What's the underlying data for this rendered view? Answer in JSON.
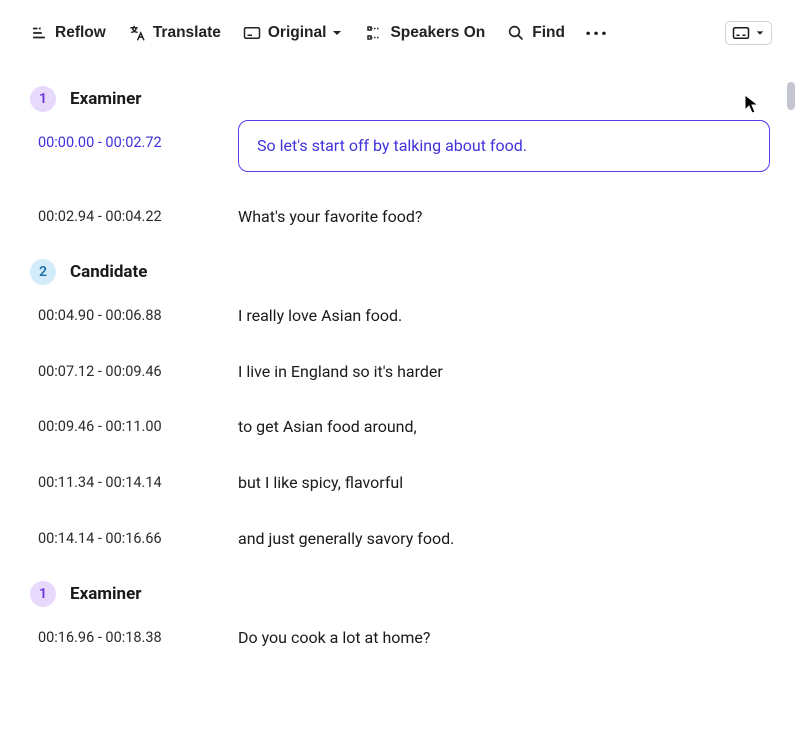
{
  "toolbar": {
    "reflow": "Reflow",
    "translate": "Translate",
    "original": "Original",
    "speakers": "Speakers On",
    "find": "Find"
  },
  "speakers": {
    "examiner": {
      "num": "1",
      "name": "Examiner"
    },
    "candidate": {
      "num": "2",
      "name": "Candidate"
    }
  },
  "lines": {
    "l1": {
      "ts": "00:00.00 - 00:02.72",
      "txt": "So let's start off by talking about food."
    },
    "l2": {
      "ts": "00:02.94 - 00:04.22",
      "txt": "What's your favorite food?"
    },
    "l3": {
      "ts": "00:04.90 - 00:06.88",
      "txt": "I really love Asian food."
    },
    "l4": {
      "ts": "00:07.12  - 00:09.46",
      "txt": "I live in England so it's harder"
    },
    "l5": {
      "ts": "00:09.46 - 00:11.00",
      "txt": "to get Asian food around,"
    },
    "l6": {
      "ts": "00:11.34  -  00:14.14",
      "txt": "but I like spicy, flavorful"
    },
    "l7": {
      "ts": "00:14.14  -  00:16.66",
      "txt": "and just generally savory food."
    },
    "l8": {
      "ts": "00:16.96  -  00:18.38",
      "txt": "Do you cook a lot at home?"
    }
  }
}
